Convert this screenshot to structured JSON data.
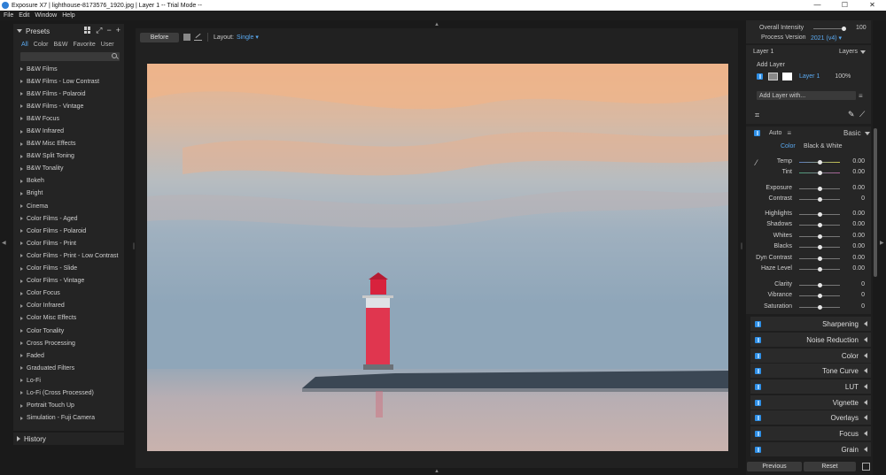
{
  "window": {
    "title": "Exposure X7 | lighthouse-8173576_1920.jpg | Layer 1 -- Trial Mode --",
    "controls": [
      "—",
      "☐",
      "✕"
    ]
  },
  "menu": [
    "File",
    "Edit",
    "Window",
    "Help"
  ],
  "presets": {
    "title": "Presets",
    "tabs": [
      "All",
      "Color",
      "B&W",
      "Favorite",
      "User"
    ],
    "active_tab": "All",
    "search_placeholder": "",
    "items": [
      "B&W Films",
      "B&W Films - Low Contrast",
      "B&W Films - Polaroid",
      "B&W Films - Vintage",
      "B&W Focus",
      "B&W Infrared",
      "B&W Misc Effects",
      "B&W Split Toning",
      "B&W Tonality",
      "Bokeh",
      "Bright",
      "Cinema",
      "Color Films - Aged",
      "Color Films - Polaroid",
      "Color Films - Print",
      "Color Films - Print - Low Contrast",
      "Color Films - Slide",
      "Color Films - Vintage",
      "Color Focus",
      "Color Infrared",
      "Color Misc Effects",
      "Color Tonality",
      "Cross Processing",
      "Faded",
      "Graduated Filters",
      "Lo-Fi",
      "Lo-Fi (Cross Processed)",
      "Portrait Touch Up",
      "Simulation - Fuji Camera"
    ]
  },
  "history": {
    "title": "History"
  },
  "toolbar": {
    "before_label": "Before",
    "layout_label": "Layout:",
    "layout_value": "Single ▾"
  },
  "right": {
    "overall_intensity_label": "Overall Intensity",
    "overall_intensity_value": "100",
    "overall_intensity_level": 1.0,
    "process_version_label": "Process Version",
    "process_version_value": "2021 (v4) ▾",
    "layer_title": "Layer 1",
    "layers_label": "Layers",
    "add_layer_label": "Add Layer",
    "layer_name": "Layer 1",
    "layer_opacity": "100%",
    "add_layer_with": "Add Layer with...",
    "auto_label": "Auto",
    "basic_label": "Basic",
    "mode_color": "Color",
    "mode_bw": "Black & White",
    "adjustments": [
      {
        "label": "Temp",
        "value": "0.00",
        "level": 0.5
      },
      {
        "label": "Tint",
        "value": "0.00",
        "level": 0.5
      },
      {
        "label": "Exposure",
        "value": "0.00",
        "level": 0.5
      },
      {
        "label": "Contrast",
        "value": "0",
        "level": 0.5
      },
      {
        "label": "Highlights",
        "value": "0.00",
        "level": 0.5
      },
      {
        "label": "Shadows",
        "value": "0.00",
        "level": 0.5
      },
      {
        "label": "Whites",
        "value": "0.00",
        "level": 0.5
      },
      {
        "label": "Blacks",
        "value": "0.00",
        "level": 0.5
      },
      {
        "label": "Dyn Contrast",
        "value": "0.00",
        "level": 0.5
      },
      {
        "label": "Haze Level",
        "value": "0.00",
        "level": 0.5
      },
      {
        "label": "Clarity",
        "value": "0",
        "level": 0.5
      },
      {
        "label": "Vibrance",
        "value": "0",
        "level": 0.5
      },
      {
        "label": "Saturation",
        "value": "0",
        "level": 0.5
      }
    ],
    "sections": [
      "Sharpening",
      "Noise Reduction",
      "Color",
      "Tone Curve",
      "LUT",
      "Vignette",
      "Overlays",
      "Focus",
      "Grain"
    ],
    "previous_label": "Previous",
    "reset_label": "Reset"
  },
  "colors": {
    "accent": "#5aa9f0",
    "toggle": "#2f8fe6",
    "panel": "#262626"
  }
}
